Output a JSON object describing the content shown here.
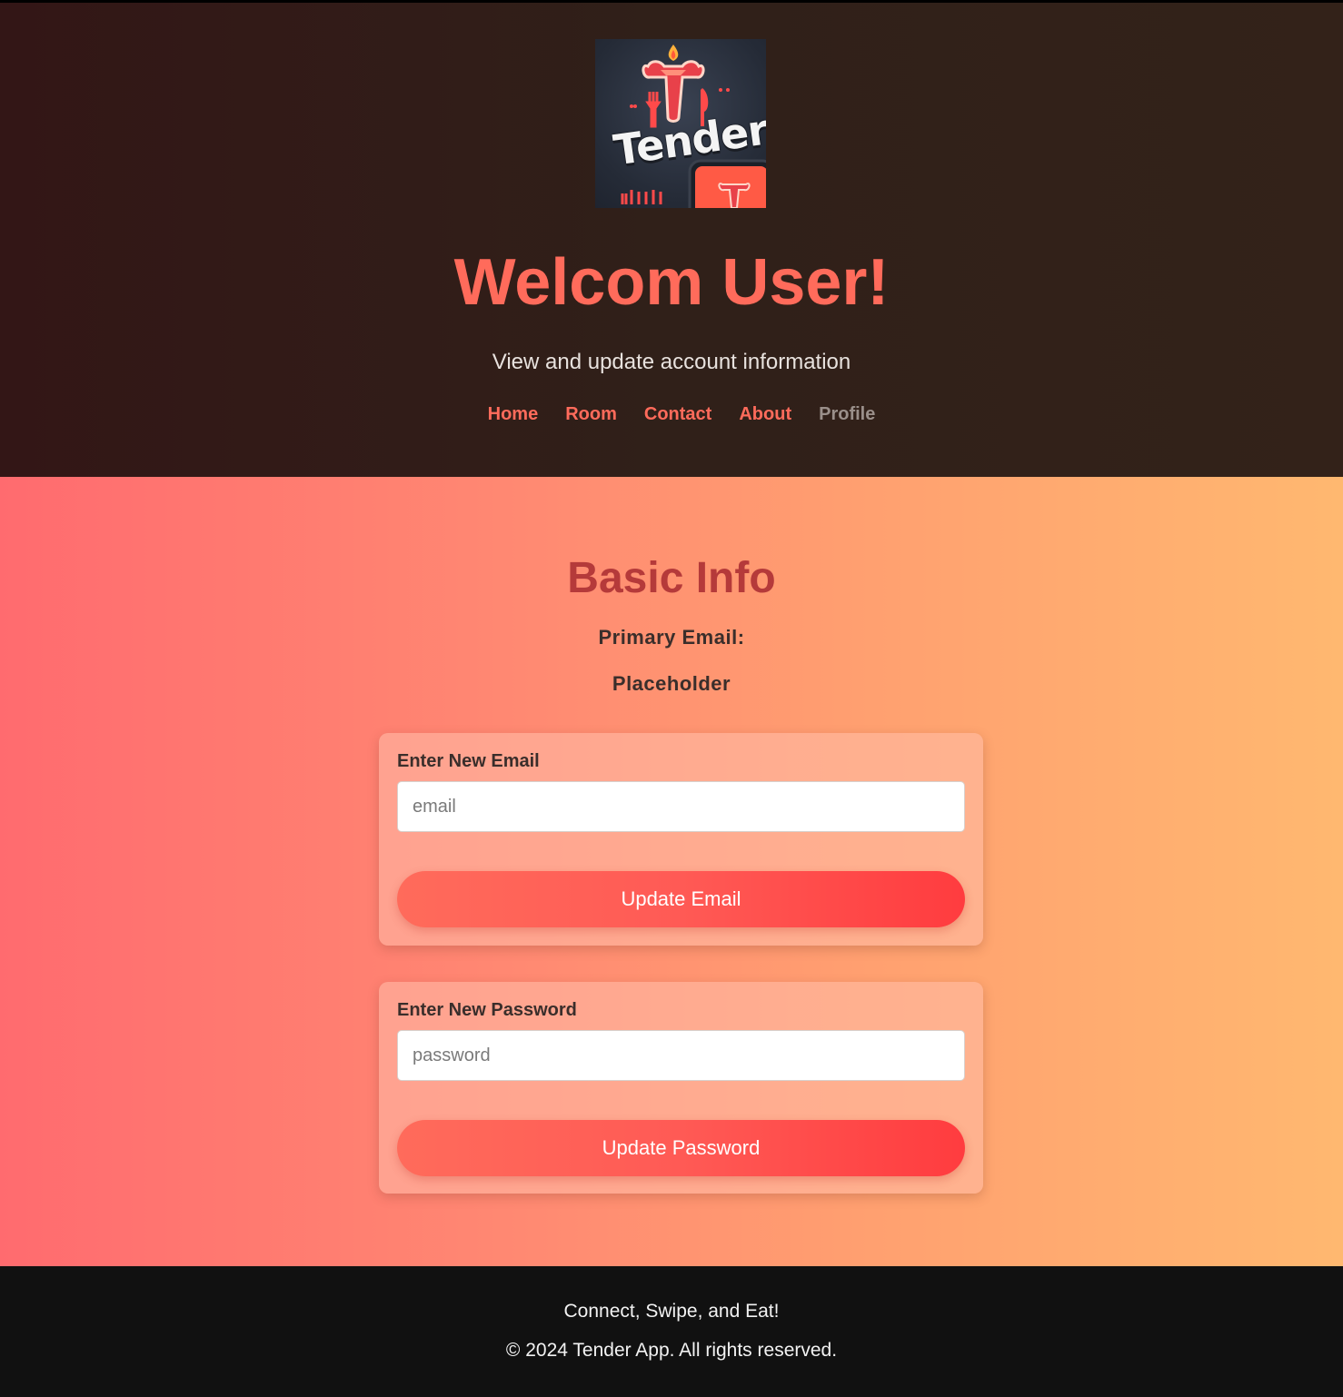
{
  "header": {
    "logo_text": "Tender",
    "title": "Welcom User!",
    "subtitle": "View and update account information"
  },
  "nav": {
    "items": [
      {
        "label": "Home"
      },
      {
        "label": "Room"
      },
      {
        "label": "Contact"
      },
      {
        "label": "About"
      },
      {
        "label": "Profile",
        "active": true
      }
    ]
  },
  "basic_info": {
    "title": "Basic Info",
    "primary_email_label": "Primary Email:",
    "primary_email_value": "Placeholder"
  },
  "email_form": {
    "label": "Enter New Email",
    "placeholder": "email",
    "value": "",
    "button_label": "Update Email"
  },
  "password_form": {
    "label": "Enter New Password",
    "placeholder": "password",
    "value": "",
    "button_label": "Update Password"
  },
  "footer": {
    "tagline": "Connect, Swipe, and Eat!",
    "copyright": "© 2024 Tender App. All rights reserved."
  },
  "colors": {
    "accent": "#ff6b5b",
    "title_red": "#b53a3a",
    "header_bg": "#331616",
    "footer_bg": "#111111"
  }
}
